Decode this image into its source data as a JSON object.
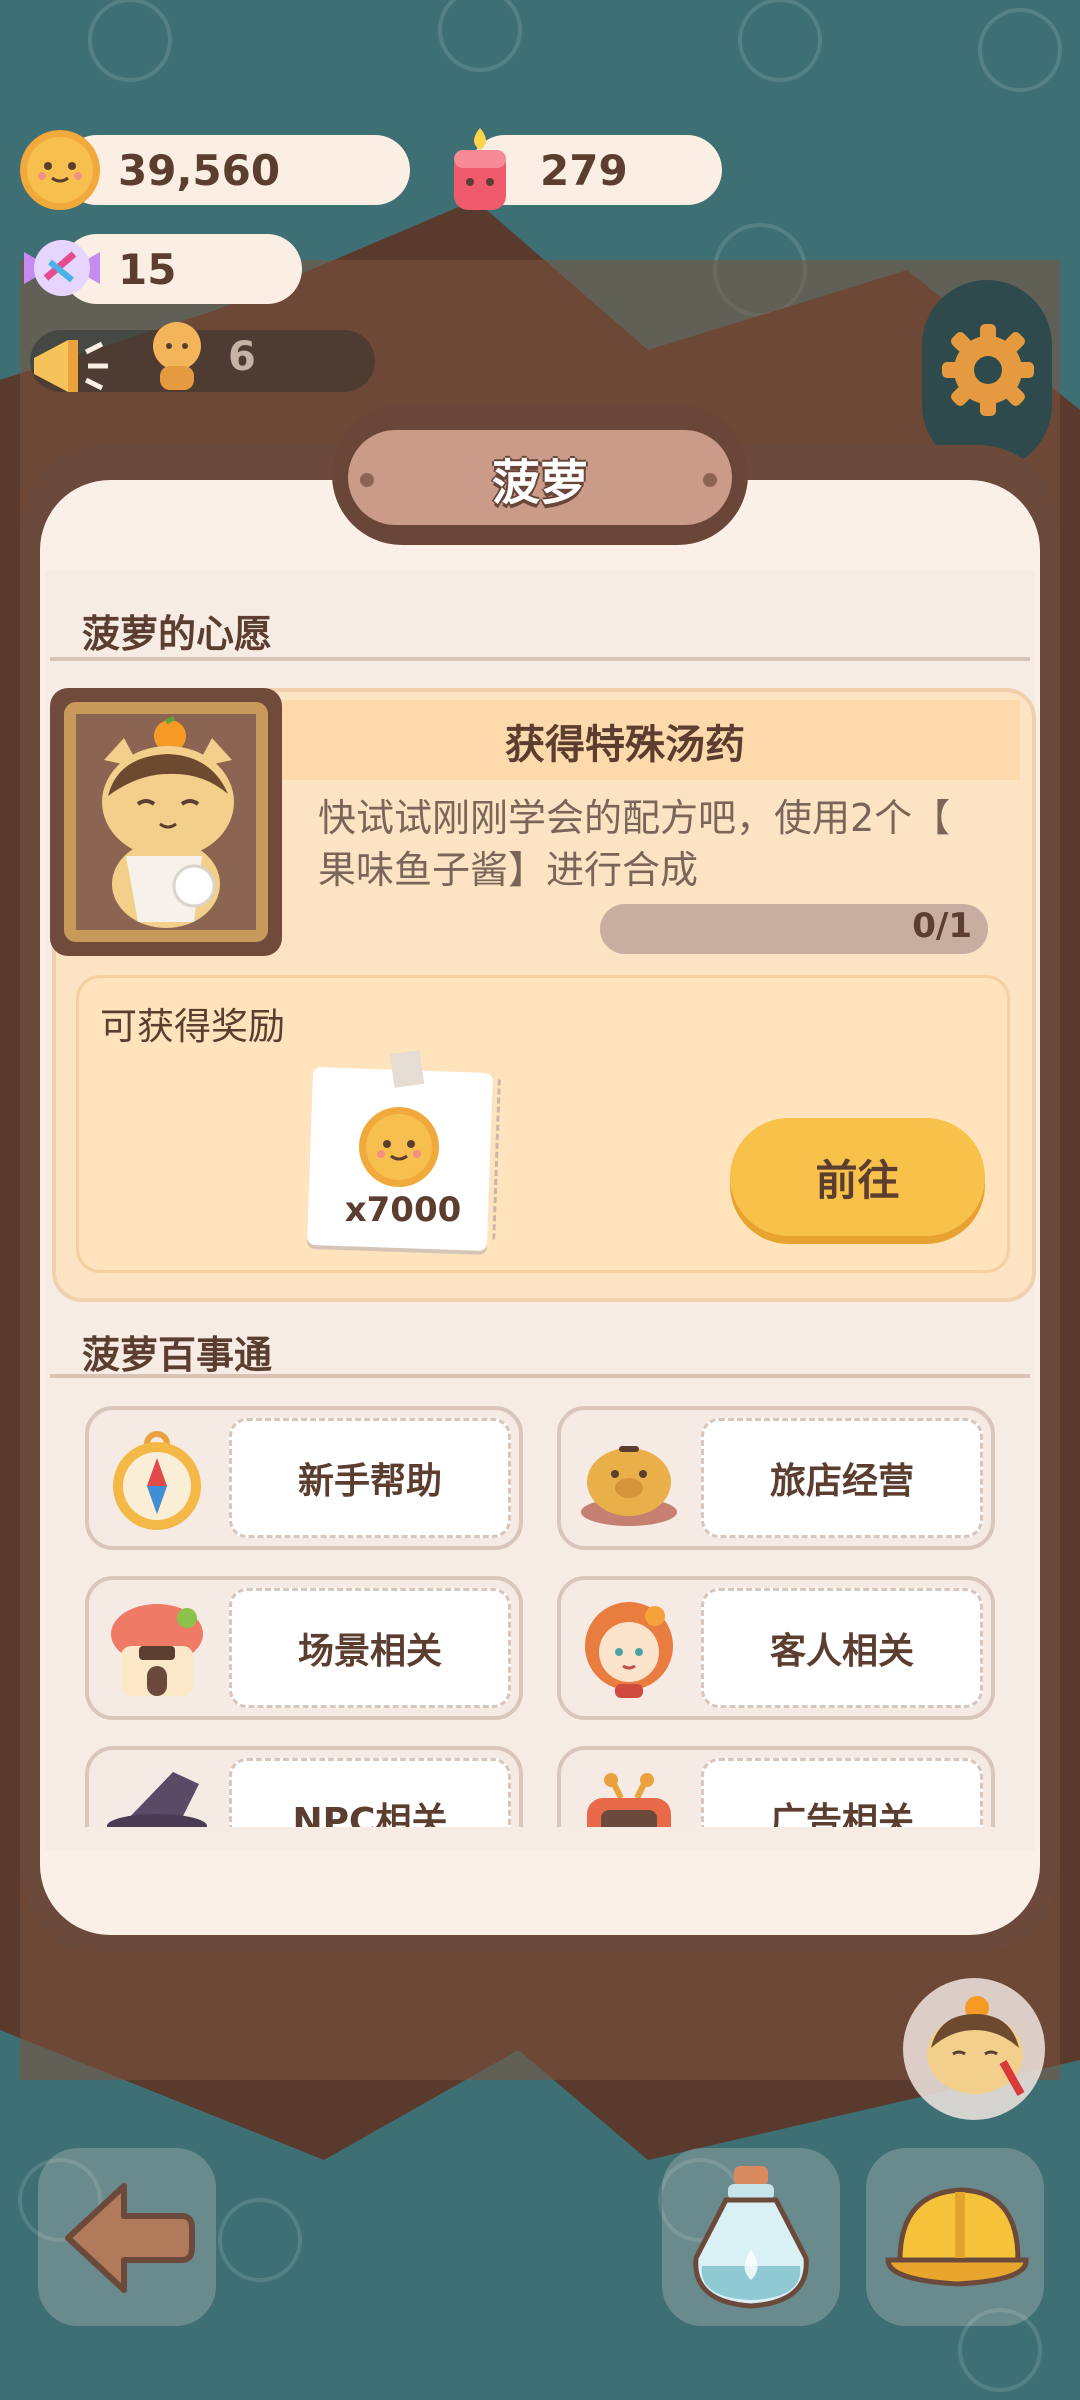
{
  "hud": {
    "cookies": "39,560",
    "candles": "279",
    "candy": "15",
    "visitors": "6"
  },
  "panel": {
    "title": "菠萝"
  },
  "wish": {
    "section_title": "菠萝的心愿",
    "task_title": "获得特殊汤药",
    "description_line1": "快试试刚刚学会的配方吧，使用2个【",
    "description_line2": "果味鱼子酱】进行合成",
    "progress_text": "0/1",
    "progress_fraction": 0,
    "reward_label": "可获得奖励",
    "reward_qty": "x7000",
    "go_label": "前往"
  },
  "faq": {
    "section_title": "菠萝百事通",
    "items": [
      {
        "label": "新手帮助",
        "icon": "compass-icon"
      },
      {
        "label": "旅店经营",
        "icon": "piggy-bank-icon"
      },
      {
        "label": "场景相关",
        "icon": "hotel-icon"
      },
      {
        "label": "客人相关",
        "icon": "guest-icon"
      },
      {
        "label": "NPC相关",
        "icon": "witch-hat-icon"
      },
      {
        "label": "广告相关",
        "icon": "tv-icon"
      }
    ]
  },
  "colors": {
    "background": "#3d6f74",
    "panel": "#fbf0e8",
    "accent_button": "#f8c24a",
    "text": "#5b3e2f"
  }
}
